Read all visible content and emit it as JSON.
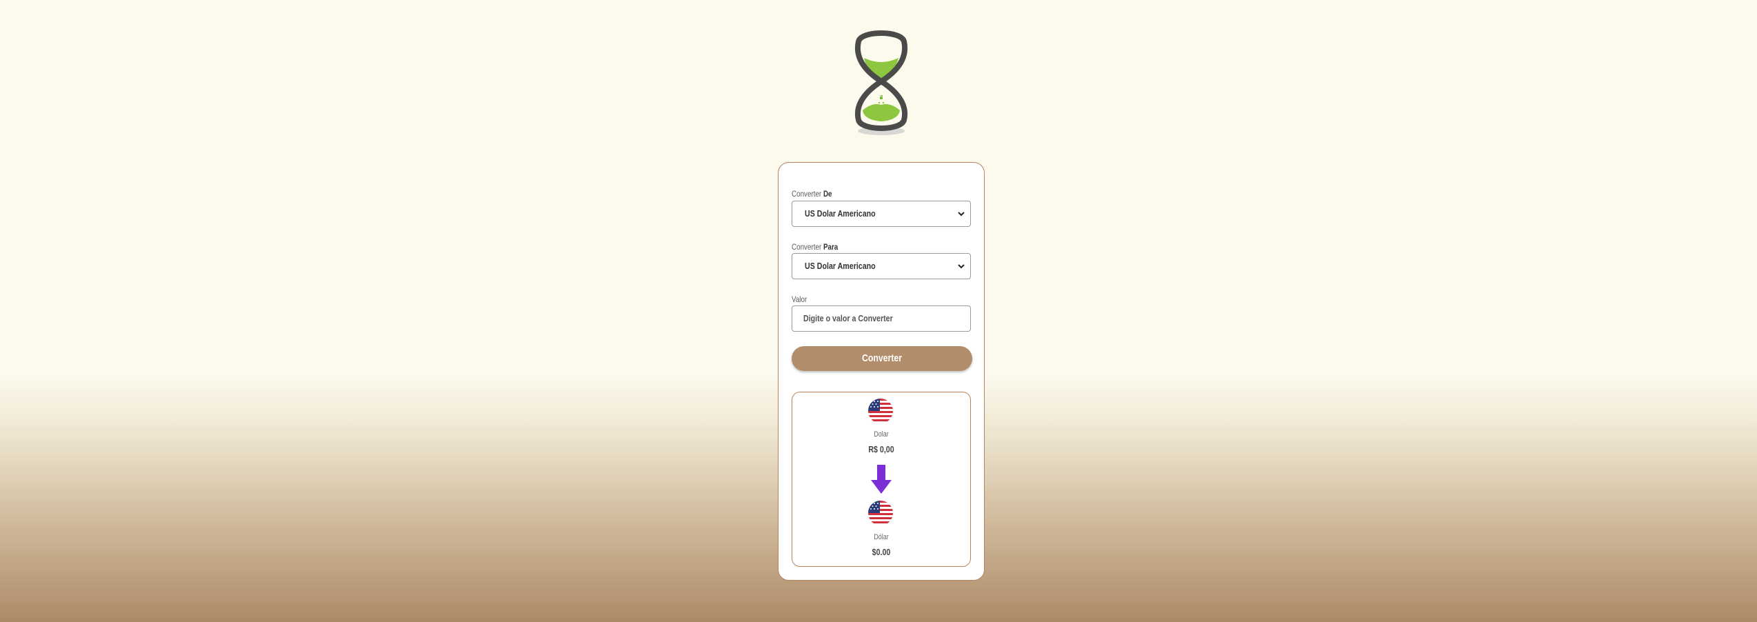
{
  "form": {
    "from_label_prefix": "Converter",
    "from_label_strong": "De",
    "from_value": "US Dolar Americano",
    "to_label_prefix": "Converter",
    "to_label_strong": "Para",
    "to_value": "US Dolar Americano",
    "amount_label": "Valor",
    "amount_placeholder": "Digite o valor a Converter",
    "amount_value": "",
    "convert_button": "Converter"
  },
  "result": {
    "from": {
      "currency": "Dolar",
      "amount": "R$ 0,00",
      "flag": "us-flag-icon"
    },
    "to": {
      "currency": "Dólar",
      "amount": "$0.00",
      "flag": "us-flag-icon"
    },
    "arrow": "arrow-down-icon"
  },
  "colors": {
    "background_top": "#fcfaed",
    "background_bottom": "#ad8a67",
    "card_border": "#b7825d",
    "button": "#b18d6c",
    "arrow": "#7b2fd6",
    "logo_sand": "#8dc63f",
    "logo_frame": "#4a4a4a"
  }
}
